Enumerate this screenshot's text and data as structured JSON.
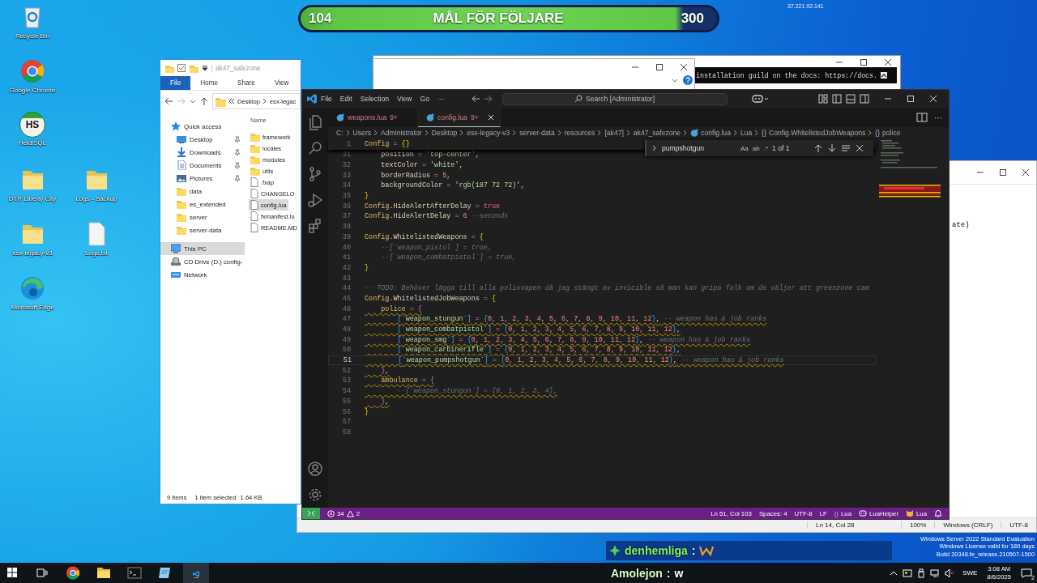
{
  "desktop": {
    "icons": [
      {
        "label": "Recycle Bin",
        "kind": "recycle"
      },
      {
        "label": "Google Chrome",
        "kind": "chrome"
      },
      {
        "label": "HeidiSQL",
        "kind": "heidi",
        "badge": "HS"
      },
      {
        "label": "DTR Liberty City",
        "kind": "folder"
      },
      {
        "label": "Logs - Backup",
        "kind": "folder"
      },
      {
        "label": "esx-legacy-v3",
        "kind": "folder"
      },
      {
        "label": "Logs.txt",
        "kind": "file"
      },
      {
        "label": "Microsoft Edge",
        "kind": "edge"
      }
    ],
    "watermark": [
      "Windows Server 2022 Standard Evaluation",
      "Windows License valid for 180 days",
      "Build 20348.fe_release.210507-1500"
    ]
  },
  "stream_overlay": {
    "goal": {
      "current": "104",
      "title": "MÅL FÖR FÖLJARE",
      "target": "300"
    },
    "ip": "37.221.92.141",
    "chat": [
      {
        "kind": "emote",
        "user": "denhemliga",
        "separator": ":",
        "badge": true
      },
      {
        "kind": "text",
        "user": "Amolejon",
        "separator": ":",
        "message": "w",
        "badge": false
      }
    ]
  },
  "terminal_window": {
    "text": "installation guild on the docs: https://docs."
  },
  "notepad": {
    "text": "ate)",
    "status_bar": [
      "Ln 14, Col 28",
      "100%",
      "Windows (CRLF)",
      "UTF-8"
    ]
  },
  "explorer": {
    "title": "ak47_safezone",
    "ribbon_tabs": [
      {
        "label": "File",
        "selected": true
      },
      {
        "label": "Home",
        "selected": false
      },
      {
        "label": "Share",
        "selected": false
      },
      {
        "label": "View",
        "selected": false
      }
    ],
    "address": [
      "Desktop",
      "esx-legac"
    ],
    "column_header": "Name",
    "nav": [
      {
        "label": "Quick access",
        "kind": "star",
        "pinned": false,
        "selected": false,
        "children": [
          {
            "label": "Desktop",
            "kind": "desktop",
            "pinned": true,
            "selected": false
          },
          {
            "label": "Downloads",
            "kind": "download",
            "pinned": true,
            "selected": false
          },
          {
            "label": "Documents",
            "kind": "document",
            "pinned": true,
            "selected": false
          },
          {
            "label": "Pictures",
            "kind": "picture",
            "pinned": true,
            "selected": false
          },
          {
            "label": "data",
            "kind": "folder",
            "pinned": false,
            "selected": false
          },
          {
            "label": "es_extended",
            "kind": "folder",
            "pinned": false,
            "selected": false
          },
          {
            "label": "server",
            "kind": "folder",
            "pinned": false,
            "selected": false
          },
          {
            "label": "server-data",
            "kind": "folder",
            "pinned": false,
            "selected": false
          }
        ]
      },
      {
        "label": "This PC",
        "kind": "pc",
        "pinned": false,
        "selected": true
      },
      {
        "label": "CD Drive (D:) config-",
        "kind": "cd",
        "pinned": false,
        "selected": false
      },
      {
        "label": "Network",
        "kind": "network",
        "pinned": false,
        "selected": false
      }
    ],
    "files": [
      {
        "name": "framework",
        "kind": "folder",
        "selected": false
      },
      {
        "name": "locales",
        "kind": "folder",
        "selected": false
      },
      {
        "name": "modules",
        "kind": "folder",
        "selected": false
      },
      {
        "name": "utils",
        "kind": "folder",
        "selected": false
      },
      {
        "name": ".fxap",
        "kind": "file",
        "selected": false
      },
      {
        "name": "CHANGELO",
        "kind": "file",
        "selected": false
      },
      {
        "name": "config.lua",
        "kind": "file",
        "selected": true
      },
      {
        "name": "fxmanifest.lu",
        "kind": "file",
        "selected": false
      },
      {
        "name": "README.MD",
        "kind": "file",
        "selected": false
      }
    ],
    "status": [
      "9 items",
      "1 item selected",
      "1.64 KB"
    ]
  },
  "vscode": {
    "menu": [
      "File",
      "Edit",
      "Selection",
      "View",
      "Go",
      "···"
    ],
    "search": "Search [Administrator]",
    "tabs": [
      {
        "label": "weapons.lua",
        "badge": "9+",
        "selected": false
      },
      {
        "label": "config.lua",
        "badge": "9+",
        "selected": true
      }
    ],
    "breadcrumb": [
      {
        "label": "C:",
        "kind": "folder"
      },
      {
        "label": "Users",
        "kind": "folder"
      },
      {
        "label": "Administrator",
        "kind": "folder"
      },
      {
        "label": "Desktop",
        "kind": "folder"
      },
      {
        "label": "esx-legacy-v3",
        "kind": "folder"
      },
      {
        "label": "server-data",
        "kind": "folder"
      },
      {
        "label": "resources",
        "kind": "folder"
      },
      {
        "label": "[ak47]",
        "kind": "folder"
      },
      {
        "label": "ak47_safezone",
        "kind": "folder"
      },
      {
        "label": "config.lua",
        "kind": "file"
      },
      {
        "label": "Lua",
        "kind": "language"
      },
      {
        "label": "Config.WhitelistedJobWeapons",
        "kind": "symbol",
        "glyph": "{}"
      },
      {
        "label": "police",
        "kind": "symbol",
        "glyph": "{}"
      }
    ],
    "find": {
      "value": "pumpshotgun",
      "toggles": [
        "Aa",
        "ab",
        ".*"
      ],
      "count": "1 of 1"
    },
    "sticky_line": {
      "number": "1",
      "tokens": [
        {
          "text": "Config",
          "kind": "ident"
        },
        {
          "text": " = ",
          "kind": "op"
        },
        {
          "text": "{}",
          "kind": "b1"
        }
      ]
    },
    "lines": [
      {
        "number": "31",
        "current": false,
        "warning": false,
        "tokens": [
          {
            "text": "    position",
            "kind": "field"
          },
          {
            "text": " = ",
            "kind": "op"
          },
          {
            "text": "'top-center'",
            "kind": "str"
          },
          {
            "text": ",",
            "kind": "punc"
          }
        ]
      },
      {
        "number": "32",
        "current": false,
        "warning": false,
        "tokens": [
          {
            "text": "    textColor",
            "kind": "field"
          },
          {
            "text": " = ",
            "kind": "op"
          },
          {
            "text": "'white'",
            "kind": "str"
          },
          {
            "text": ",",
            "kind": "punc"
          }
        ]
      },
      {
        "number": "33",
        "current": false,
        "warning": false,
        "tokens": [
          {
            "text": "    borderRadius",
            "kind": "field"
          },
          {
            "text": " = ",
            "kind": "op"
          },
          {
            "text": "5",
            "kind": "num"
          },
          {
            "text": ",",
            "kind": "punc"
          }
        ]
      },
      {
        "number": "34",
        "current": false,
        "warning": false,
        "tokens": [
          {
            "text": "    backgroundColor",
            "kind": "field"
          },
          {
            "text": " = ",
            "kind": "op"
          },
          {
            "text": "'rgb(187 72 72)'",
            "kind": "str"
          },
          {
            "text": ",",
            "kind": "punc"
          }
        ]
      },
      {
        "number": "35",
        "current": false,
        "warning": false,
        "tokens": [
          {
            "text": "}",
            "kind": "b1"
          }
        ]
      },
      {
        "number": "36",
        "current": false,
        "warning": false,
        "tokens": [
          {
            "text": "Config",
            "kind": "ident"
          },
          {
            "text": ".",
            "kind": "punc"
          },
          {
            "text": "HideAlertAfterDelay",
            "kind": "field"
          },
          {
            "text": " = ",
            "kind": "op"
          },
          {
            "text": "true",
            "kind": "bool"
          }
        ]
      },
      {
        "number": "37",
        "current": false,
        "warning": false,
        "tokens": [
          {
            "text": "Config",
            "kind": "ident"
          },
          {
            "text": ".",
            "kind": "punc"
          },
          {
            "text": "HideAlertDelay",
            "kind": "field"
          },
          {
            "text": " = ",
            "kind": "op"
          },
          {
            "text": "6",
            "kind": "num"
          },
          {
            "text": " --seconds",
            "kind": "cmt"
          }
        ]
      },
      {
        "number": "38",
        "current": false
      },
      {
        "number": "39",
        "current": false,
        "warning": false,
        "tokens": [
          {
            "text": "Config",
            "kind": "ident"
          },
          {
            "text": ".",
            "kind": "punc"
          },
          {
            "text": "WhitelistedWeapons",
            "kind": "field"
          },
          {
            "text": " = ",
            "kind": "op"
          },
          {
            "text": "{",
            "kind": "b1"
          }
        ]
      },
      {
        "number": "40",
        "current": false,
        "warning": false,
        "tokens": [
          {
            "text": "    --[`weapon_pistol`] = true,",
            "kind": "cmt"
          }
        ]
      },
      {
        "number": "41",
        "current": false,
        "warning": false,
        "tokens": [
          {
            "text": "    --[`weapon_combatpistol`] = true,",
            "kind": "cmt"
          }
        ]
      },
      {
        "number": "42",
        "current": false,
        "warning": false,
        "tokens": [
          {
            "text": "}",
            "kind": "b1"
          }
        ]
      },
      {
        "number": "43",
        "current": false
      },
      {
        "number": "44",
        "current": false,
        "warning": false,
        "tokens": [
          {
            "text": "-- TODO: Behöver lägga till alla polisvapen då jag stängt av invicible så man kan gripa folk om de väljer att greenzone cam",
            "kind": "cmt"
          }
        ]
      },
      {
        "number": "45",
        "current": false,
        "warning": false,
        "tokens": [
          {
            "text": "Config",
            "kind": "ident"
          },
          {
            "text": ".",
            "kind": "punc"
          },
          {
            "text": "WhitelistedJobWeapons",
            "kind": "field"
          },
          {
            "text": " = ",
            "kind": "op"
          },
          {
            "text": "{",
            "kind": "b1"
          }
        ]
      },
      {
        "number": "46",
        "current": false,
        "warning": true,
        "tokens": [
          {
            "text": "    police",
            "kind": "ident"
          },
          {
            "text": " = ",
            "kind": "op"
          },
          {
            "text": "{",
            "kind": "b2"
          }
        ]
      },
      {
        "number": "47",
        "current": false,
        "warning": true,
        "tokens": [
          {
            "text": "        [",
            "kind": "b3"
          },
          {
            "text": "`weapon_stungun`",
            "kind": "str"
          },
          {
            "text": "]",
            "kind": "b3"
          },
          {
            "text": " = ",
            "kind": "op"
          },
          {
            "text": "{",
            "kind": "b3"
          },
          {
            "text": "0, 1, 2, 3, 4, 5, 6, 7, 8, 9, 10, 11, 12",
            "kind": "num"
          },
          {
            "text": "}",
            "kind": "b3"
          },
          {
            "text": ",",
            "kind": "punc"
          },
          {
            "text": " -- weapon has & job ranks",
            "kind": "cmt"
          }
        ]
      },
      {
        "number": "48",
        "current": false,
        "warning": true,
        "tokens": [
          {
            "text": "        [",
            "kind": "b3"
          },
          {
            "text": "`weapon_combatpistol`",
            "kind": "str"
          },
          {
            "text": "]",
            "kind": "b3"
          },
          {
            "text": " = ",
            "kind": "op"
          },
          {
            "text": "{",
            "kind": "b3"
          },
          {
            "text": "0, 1, 2, 3, 4, 5, 6, 7, 8, 9, 10, 11, 12",
            "kind": "num"
          },
          {
            "text": "}",
            "kind": "b3"
          },
          {
            "text": ",",
            "kind": "punc"
          }
        ]
      },
      {
        "number": "49",
        "current": false,
        "warning": true,
        "tokens": [
          {
            "text": "        [",
            "kind": "b3"
          },
          {
            "text": "`weapon_smg`",
            "kind": "str"
          },
          {
            "text": "]",
            "kind": "b3"
          },
          {
            "text": " = ",
            "kind": "op"
          },
          {
            "text": "{",
            "kind": "b3"
          },
          {
            "text": "0, 1, 2, 3, 4, 5, 6, 7, 8, 9, 10, 11, 12",
            "kind": "num"
          },
          {
            "text": "}",
            "kind": "b3"
          },
          {
            "text": ",",
            "kind": "punc"
          },
          {
            "text": " -- weapon has & job ranks",
            "kind": "cmt"
          }
        ]
      },
      {
        "number": "50",
        "current": false,
        "warning": true,
        "tokens": [
          {
            "text": "        [",
            "kind": "b3"
          },
          {
            "text": "`weapon_carbinerifle`",
            "kind": "str"
          },
          {
            "text": "]",
            "kind": "b3"
          },
          {
            "text": " = ",
            "kind": "op"
          },
          {
            "text": "{",
            "kind": "b3"
          },
          {
            "text": "0, 1, 2, 3, 4, 5, 6, 7, 8, 9, 10, 11, 12",
            "kind": "num"
          },
          {
            "text": "}",
            "kind": "b3"
          },
          {
            "text": ",",
            "kind": "punc"
          }
        ]
      },
      {
        "number": "51",
        "current": true,
        "warning": true,
        "tokens": [
          {
            "text": "        [",
            "kind": "b3"
          },
          {
            "text": "`weapon_pumpshotgun`",
            "kind": "str"
          },
          {
            "text": "]",
            "kind": "b3"
          },
          {
            "text": " = ",
            "kind": "op"
          },
          {
            "text": "{",
            "kind": "b3"
          },
          {
            "text": "0, 1, 2, 3, 4, 5, 6, 7, 8, 9, 10, 11, 12",
            "kind": "num"
          },
          {
            "text": "}",
            "kind": "b3"
          },
          {
            "text": ",",
            "kind": "punc"
          },
          {
            "text": " -- weapon has & job ranks",
            "kind": "cmt"
          }
        ]
      },
      {
        "number": "52",
        "current": false,
        "warning": true,
        "tokens": [
          {
            "text": "    }",
            "kind": "b2"
          },
          {
            "text": ",",
            "kind": "punc"
          }
        ]
      },
      {
        "number": "53",
        "current": false,
        "warning": true,
        "tokens": [
          {
            "text": "    ambulance",
            "kind": "ident"
          },
          {
            "text": " = ",
            "kind": "op"
          },
          {
            "text": "{",
            "kind": "b2"
          }
        ]
      },
      {
        "number": "54",
        "current": false,
        "warning": true,
        "tokens": [
          {
            "text": "        --[`weapon_stungun`] = {0, 1, 2, 3, 4},",
            "kind": "cmt"
          }
        ]
      },
      {
        "number": "55",
        "current": false,
        "warning": true,
        "tokens": [
          {
            "text": "    }",
            "kind": "b2"
          },
          {
            "text": ",",
            "kind": "punc"
          }
        ]
      },
      {
        "number": "56",
        "current": false,
        "warning": false,
        "tokens": [
          {
            "text": "}",
            "kind": "b1"
          }
        ]
      },
      {
        "number": "57",
        "current": false
      },
      {
        "number": "58",
        "current": false
      }
    ],
    "status": {
      "errors": "34",
      "warnings": "2",
      "items": [
        {
          "label": "Ln 51, Col 103",
          "kind": "position"
        },
        {
          "label": "Spaces: 4",
          "kind": "indent"
        },
        {
          "label": "UTF-8",
          "kind": "encoding"
        },
        {
          "label": "LF",
          "kind": "eol"
        },
        {
          "label": "Lua",
          "kind": "language",
          "glyph": "{}"
        },
        {
          "label": "LuaHelper",
          "kind": "extension"
        },
        {
          "label": "Lua",
          "kind": "mode"
        }
      ]
    }
  },
  "taskbar": {
    "apps": [
      {
        "kind": "chrome",
        "active": false
      },
      {
        "kind": "explorer",
        "active": false
      },
      {
        "kind": "terminal",
        "active": false
      },
      {
        "kind": "notepad",
        "active": false
      },
      {
        "kind": "vscode",
        "active": true
      }
    ],
    "tray": {
      "language": "SWE",
      "time": "3:08 AM",
      "date": "8/6/2025",
      "notifications": "2"
    }
  }
}
